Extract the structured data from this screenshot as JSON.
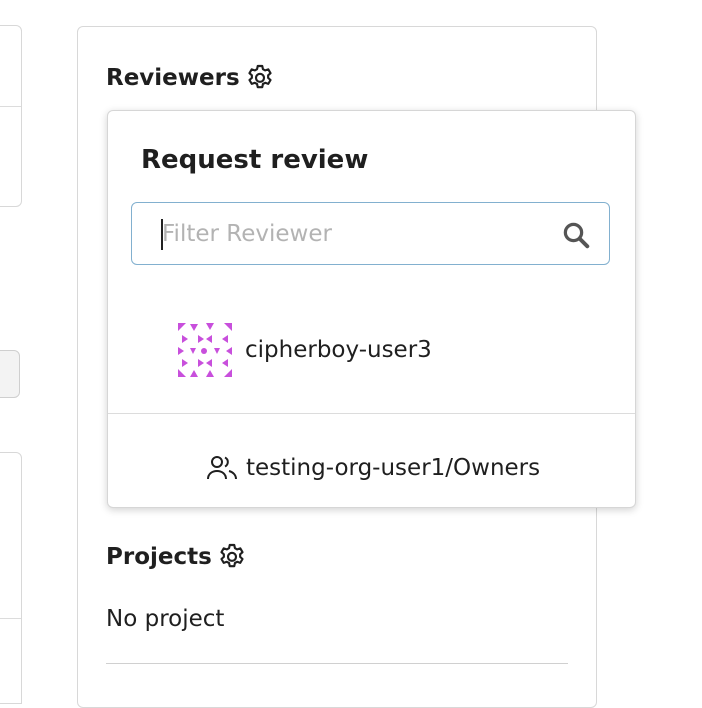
{
  "sidebar": {
    "reviewers_title": "Reviewers",
    "projects_title": "Projects",
    "no_project": "No project"
  },
  "popup": {
    "title": "Request review",
    "filter_placeholder": "Filter Reviewer",
    "reviewers": [
      {
        "name": "cipherboy-user3",
        "icon": "identicon-avatar"
      }
    ],
    "teams": [
      {
        "name": "testing-org-user1/Owners",
        "icon": "people-icon"
      }
    ]
  },
  "colors": {
    "focus_border": "#82b0cf",
    "avatar_accent": "#c84fdc",
    "text": "#1f1f1f"
  }
}
